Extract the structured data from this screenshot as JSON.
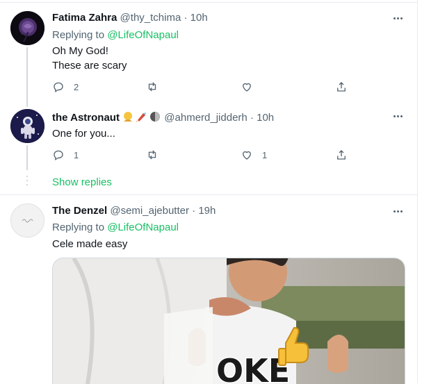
{
  "tweets": [
    {
      "name": "Fatima Zahra",
      "handle": "@thy_tchima",
      "separator": "·",
      "time": "10h",
      "replying_prefix": "Replying to",
      "replying_to": "@LifeOfNapaul",
      "text_lines": [
        "Oh My God!",
        "These are scary"
      ],
      "counts": {
        "reply": "2",
        "retweet": "",
        "like": ""
      }
    },
    {
      "name": "the Astronaut",
      "handle": "@ahmerd_jidderh",
      "separator": "·",
      "time": "10h",
      "text_lines": [
        "One for you..."
      ],
      "counts": {
        "reply": "1",
        "retweet": "",
        "like": "1"
      }
    },
    {
      "name": "The Denzel",
      "handle": "@semi_ajebutter",
      "separator": "·",
      "time": "19h",
      "replying_prefix": "Replying to",
      "replying_to": "@LifeOfNapaul",
      "text_lines": [
        "Cele made easy"
      ]
    }
  ],
  "show_replies": "Show replies",
  "media_caption": "OKE",
  "icons": [
    "reply-icon",
    "retweet-icon",
    "like-icon",
    "share-icon",
    "more-icon"
  ],
  "colors": {
    "accent": "#17bf63",
    "secondary_text": "#536471",
    "border": "#e6ecf0"
  }
}
